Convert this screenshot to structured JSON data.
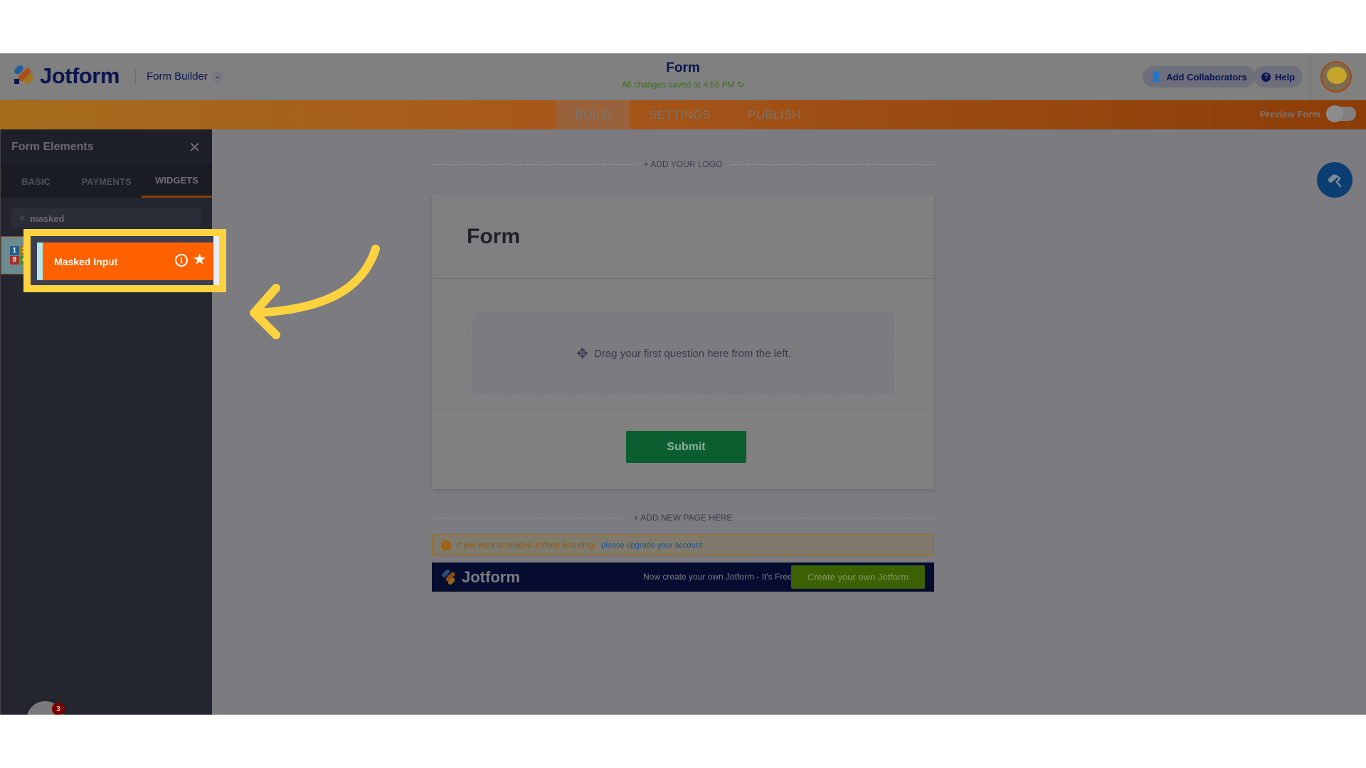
{
  "header": {
    "logo_text": "Jotform",
    "builder_label": "Form Builder",
    "form_title": "Form",
    "saved_status": "All changes saved at 4:58 PM",
    "add_collaborators": "Add Collaborators",
    "help": "Help"
  },
  "nav": {
    "tabs": [
      {
        "label": "BUILD",
        "active": true
      },
      {
        "label": "SETTINGS",
        "active": false
      },
      {
        "label": "PUBLISH",
        "active": false
      }
    ],
    "preview_label": "Preview Form",
    "preview_on": false
  },
  "sidebar": {
    "title": "Form Elements",
    "tabs": [
      {
        "label": "BASIC",
        "active": false
      },
      {
        "label": "PAYMENTS",
        "active": false
      },
      {
        "label": "WIDGETS",
        "active": true
      }
    ],
    "search_value": "masked",
    "results": [
      {
        "label": "Masked Input",
        "icon_digits": [
          "1",
          "3",
          "8",
          "4"
        ]
      }
    ]
  },
  "extension_badge_count": "3",
  "canvas": {
    "add_logo": "+ ADD YOUR LOGO",
    "form_heading": "Form",
    "dropzone_text": "Drag your first question here from the left.",
    "submit_label": "Submit",
    "add_page": "+ ADD NEW PAGE HERE",
    "branding_warning": "If you want to remove Jotform Branding,",
    "branding_link": "please upgrade your account",
    "banner_logo": "Jotform",
    "banner_text": "Now create your own Jotform - It's Free",
    "banner_button": "Create your own Jotform"
  },
  "colors": {
    "brand_orange": "#ff6100",
    "highlight_yellow": "#ffd23f",
    "submit_green": "#0b5e30",
    "paint_button_blue": "#0b3f73"
  }
}
